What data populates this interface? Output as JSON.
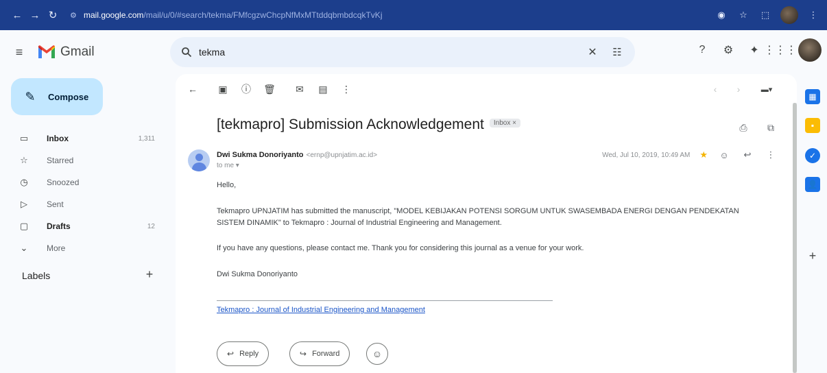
{
  "browser": {
    "url_host": "mail.google.com",
    "url_path": "/mail/u/0/#search/tekma/FMfcgzwChcpNfMxMTtddqbmbdcqkTvKj"
  },
  "gmail": {
    "logo_text": "Gmail",
    "search": {
      "value": "tekma"
    },
    "compose_label": "Compose",
    "nav": [
      {
        "label": "Inbox",
        "count": "1,311",
        "bold": true,
        "icon": "inbox-icon"
      },
      {
        "label": "Starred",
        "count": "",
        "bold": false,
        "icon": "star-icon"
      },
      {
        "label": "Snoozed",
        "count": "",
        "bold": false,
        "icon": "clock-icon"
      },
      {
        "label": "Sent",
        "count": "",
        "bold": false,
        "icon": "send-icon"
      },
      {
        "label": "Drafts",
        "count": "12",
        "bold": true,
        "icon": "draft-icon"
      },
      {
        "label": "More",
        "count": "",
        "bold": false,
        "icon": "chevron-down-icon"
      }
    ],
    "labels_heading": "Labels"
  },
  "email": {
    "subject": "[tekmapro] Submission Acknowledgement",
    "tag": "Inbox ×",
    "sender_name": "Dwi Sukma Donoriyanto",
    "sender_email": "<ernp@upnjatim.ac.id>",
    "to": "to me ▾",
    "date": "Wed, Jul 10, 2019, 10:49 AM",
    "body": [
      "Hello,",
      "Tekmapro UPNJATIM has submitted the manuscript, \"MODEL KEBIJAKAN POTENSI SORGUM UNTUK SWASEMBADA ENERGI DENGAN PENDEKATAN SISTEM DINAMIK\" to Tekmapro : Journal of Industrial Engineering and Management.",
      "If you have any questions, please contact me. Thank you for considering this journal as a venue for your work.",
      "Dwi Sukma Donoriyanto"
    ],
    "footer_link": "Tekmapro : Journal of Industrial Engineering and Management",
    "reply_label": "Reply",
    "forward_label": "Forward"
  },
  "colors": {
    "browser_bar": "#1c3e8c",
    "compose_bg": "#c2e7ff",
    "search_bg": "#eaf1fb",
    "link": "#1a55c8",
    "star": "#f4b400"
  }
}
